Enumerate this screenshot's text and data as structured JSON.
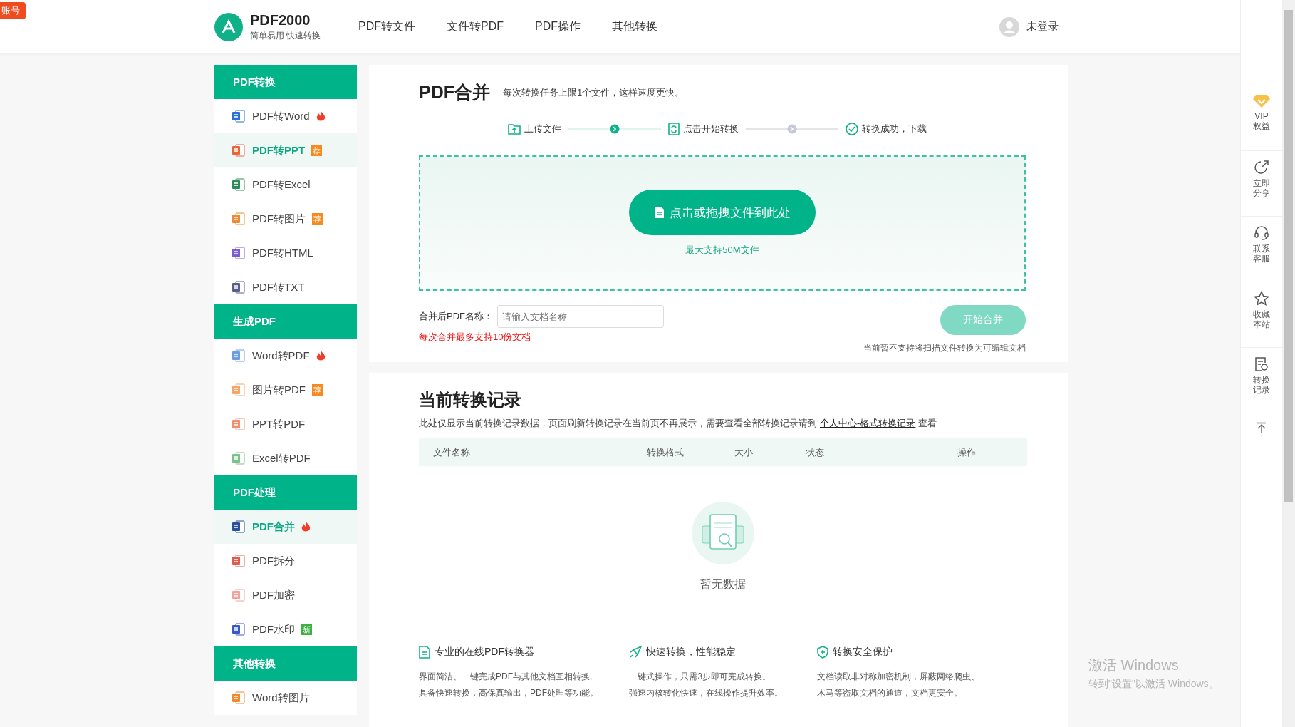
{
  "corner_tag": "账号",
  "header": {
    "logo_title": "PDF2000",
    "logo_subtitle": "简单易用 快速转换",
    "nav": [
      {
        "label": "PDF转文件"
      },
      {
        "label": "文件转PDF"
      },
      {
        "label": "PDF操作"
      },
      {
        "label": "其他转换"
      }
    ],
    "user": "未登录"
  },
  "sidebar": [
    {
      "title": "PDF转换",
      "items": [
        {
          "label": "PDF转Word",
          "color": "#2b6fd1",
          "hot": true,
          "selected": false
        },
        {
          "label": "PDF转PPT",
          "color": "#e8673a",
          "badge": {
            "text": "荐",
            "kind": "recommend"
          },
          "selected": true
        },
        {
          "label": "PDF转Excel",
          "color": "#2e8b57",
          "selected": false
        },
        {
          "label": "PDF转图片",
          "color": "#f08a30",
          "badge": {
            "text": "荐",
            "kind": "recommend"
          },
          "selected": false
        },
        {
          "label": "PDF转HTML",
          "color": "#7a5cd6",
          "selected": false
        },
        {
          "label": "PDF转TXT",
          "color": "#5a5f8a",
          "selected": false
        }
      ]
    },
    {
      "title": "生成PDF",
      "items": [
        {
          "label": "Word转PDF",
          "color": "#6a9ee0",
          "hot": true,
          "selected": false
        },
        {
          "label": "图片转PDF",
          "color": "#f3a56a",
          "badge": {
            "text": "荐",
            "kind": "recommend"
          },
          "selected": false
        },
        {
          "label": "PPT转PDF",
          "color": "#ef8f70",
          "selected": false
        },
        {
          "label": "Excel转PDF",
          "color": "#7bbf8e",
          "selected": false
        }
      ]
    },
    {
      "title": "PDF处理",
      "items": [
        {
          "label": "PDF合并",
          "color": "#2a4fa0",
          "hot": true,
          "selected": true
        },
        {
          "label": "PDF拆分",
          "color": "#e05a4e",
          "selected": false
        },
        {
          "label": "PDF加密",
          "color": "#f2a39a",
          "selected": false
        },
        {
          "label": "PDF水印",
          "color": "#3a57c8",
          "badge": {
            "text": "新",
            "kind": "new"
          },
          "selected": false
        }
      ]
    },
    {
      "title": "其他转换",
      "items": [
        {
          "label": "Word转图片",
          "color": "#f08a30",
          "selected": false
        }
      ]
    }
  ],
  "tool": {
    "title": "PDF合并",
    "note": "每次转换任务上限1个文件，这样速度更快。",
    "steps": [
      {
        "label": "上传文件"
      },
      {
        "label": "点击开始转换"
      },
      {
        "label": "转换成功，下载"
      }
    ],
    "connectors": [
      {
        "active": true
      },
      {
        "active": false
      }
    ],
    "upload_button": "点击或拖拽文件到此处",
    "upload_hint": "最大支持50M文件",
    "name_label": "合并后PDF名称：",
    "name_placeholder": "请输入文档名称",
    "limit_note": "每次合并最多支持10份文档",
    "start_button": "开始合并",
    "start_disabled": true,
    "scan_note": "当前暂不支持将扫描文件转换为可编辑文档"
  },
  "records": {
    "title": "当前转换记录",
    "desc": "此处仅显示当前转换记录数据，页面刷新转换记录在当前页不再展示，需要查看全部转换记录请到",
    "link": "个人中心-格式转换记录",
    "desc_end": "查看",
    "columns": [
      "文件名称",
      "转换格式",
      "大小",
      "状态",
      "操作"
    ],
    "empty": "暂无数据"
  },
  "features": [
    {
      "title": "专业的在线PDF转换器",
      "lines": [
        "界面简洁、一键完成PDF与其他文档互相转换,",
        "具备快速转换，高保真输出，PDF处理等功能。"
      ]
    },
    {
      "title": "快速转换，性能稳定",
      "lines": [
        "一键式操作，只需3步即可完成转换。",
        "强速内核转化快速，在线操作提升效率。"
      ]
    },
    {
      "title": "转换安全保护",
      "lines": [
        "文档读取非对称加密机制，屏蔽网络爬虫、",
        "木马等盗取文档的通道，文档更安全。"
      ]
    }
  ],
  "right_bar": [
    {
      "kind": "vip",
      "label": "VIP权益"
    },
    {
      "kind": "share",
      "label": "立即分享"
    },
    {
      "kind": "service",
      "label": "联系客服"
    },
    {
      "kind": "star",
      "label": "收藏本站"
    },
    {
      "kind": "record",
      "label": "转换记录"
    },
    {
      "kind": "top"
    }
  ],
  "os_watermark": {
    "title": "激活 Windows",
    "subtitle": "转到\"设置\"以激活 Windows。"
  }
}
